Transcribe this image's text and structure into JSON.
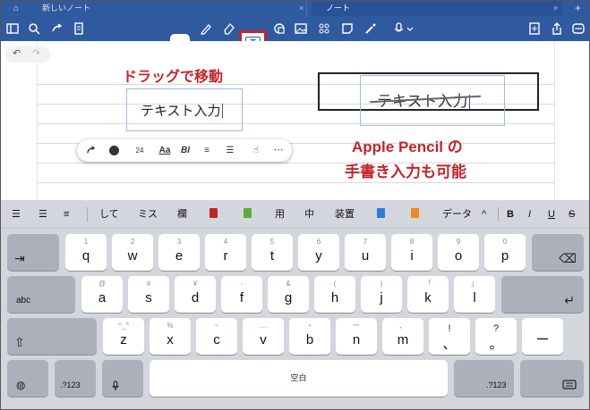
{
  "tabs": {
    "home_icon": "⌂",
    "new_note": "新しいノート",
    "note": "ノート",
    "close": "×",
    "add": "+"
  },
  "toolbar": {
    "icons": [
      "sidebar-icon",
      "search-icon",
      "share-arrow-icon",
      "document-icon",
      "lasso-icon",
      "pen-icon",
      "eraser-icon",
      "textbox-icon",
      "shape-icon",
      "image-icon",
      "sticker-icon",
      "sticky-note-icon",
      "laser-icon",
      "mic-icon",
      "new-page-icon",
      "export-icon",
      "more-icon"
    ],
    "textbox_glyph": "T",
    "highlight_color": "#c0252b",
    "accent": "#2f5aa0"
  },
  "note": {
    "undo": "↶",
    "redo": "↷",
    "caption_drag": "ドラッグで移動",
    "textbox1": "テキスト入力",
    "handwritten": "テキスト入力",
    "caption_pencil_line1": "Apple Pencil の",
    "caption_pencil_line2": "手書き入力も可能",
    "caption_color": "#c0252b"
  },
  "format_bar": {
    "font_size": "24",
    "items": [
      "↶+",
      "●",
      "24",
      "Aa",
      "BI",
      "≡",
      "☰",
      "☝",
      "⋯"
    ]
  },
  "keyboard": {
    "suggestions": [
      "して",
      "ミス",
      "欄",
      "",
      "",
      "用",
      "中",
      "装置",
      "",
      "",
      "データ"
    ],
    "right_tools": [
      "^",
      "B",
      "I",
      "U",
      "S"
    ],
    "row1": [
      {
        "main": "q",
        "sub": "1"
      },
      {
        "main": "w",
        "sub": "2"
      },
      {
        "main": "e",
        "sub": "3"
      },
      {
        "main": "r",
        "sub": "4"
      },
      {
        "main": "t",
        "sub": "5"
      },
      {
        "main": "y",
        "sub": "6"
      },
      {
        "main": "u",
        "sub": "7"
      },
      {
        "main": "i",
        "sub": "8"
      },
      {
        "main": "o",
        "sub": "9"
      },
      {
        "main": "p",
        "sub": "0"
      }
    ],
    "row2": [
      {
        "main": "a",
        "sub": "@"
      },
      {
        "main": "s",
        "sub": "#"
      },
      {
        "main": "d",
        "sub": "¥"
      },
      {
        "main": "f",
        "sub": "-"
      },
      {
        "main": "g",
        "sub": "&"
      },
      {
        "main": "h",
        "sub": "("
      },
      {
        "main": "j",
        "sub": ")"
      },
      {
        "main": "k",
        "sub": "「"
      },
      {
        "main": "l",
        "sub": "」"
      }
    ],
    "row3": [
      {
        "main": "z",
        "sub": "^_^"
      },
      {
        "main": "x",
        "sub": "%"
      },
      {
        "main": "c",
        "sub": "~"
      },
      {
        "main": "v",
        "sub": "…"
      },
      {
        "main": "b",
        "sub": "・"
      },
      {
        "main": "n",
        "sub": "ー"
      },
      {
        "main": "m",
        "sub": "、"
      },
      {
        "main": "!",
        "sub": "!"
      },
      {
        "main": "?",
        "sub": "?"
      }
    ],
    "row3_special": {
      "bang_main": "、",
      "q_main": "。"
    },
    "tab": "⇥",
    "delete": "⌫",
    "abc": "abc",
    "return": "↵",
    "shift": "⇧",
    "dash": "ー",
    "globe": "🌐",
    "num1": ".?123",
    "mic": "🎤",
    "space": "空白",
    "num2": ".?123",
    "hide": "⌨"
  }
}
